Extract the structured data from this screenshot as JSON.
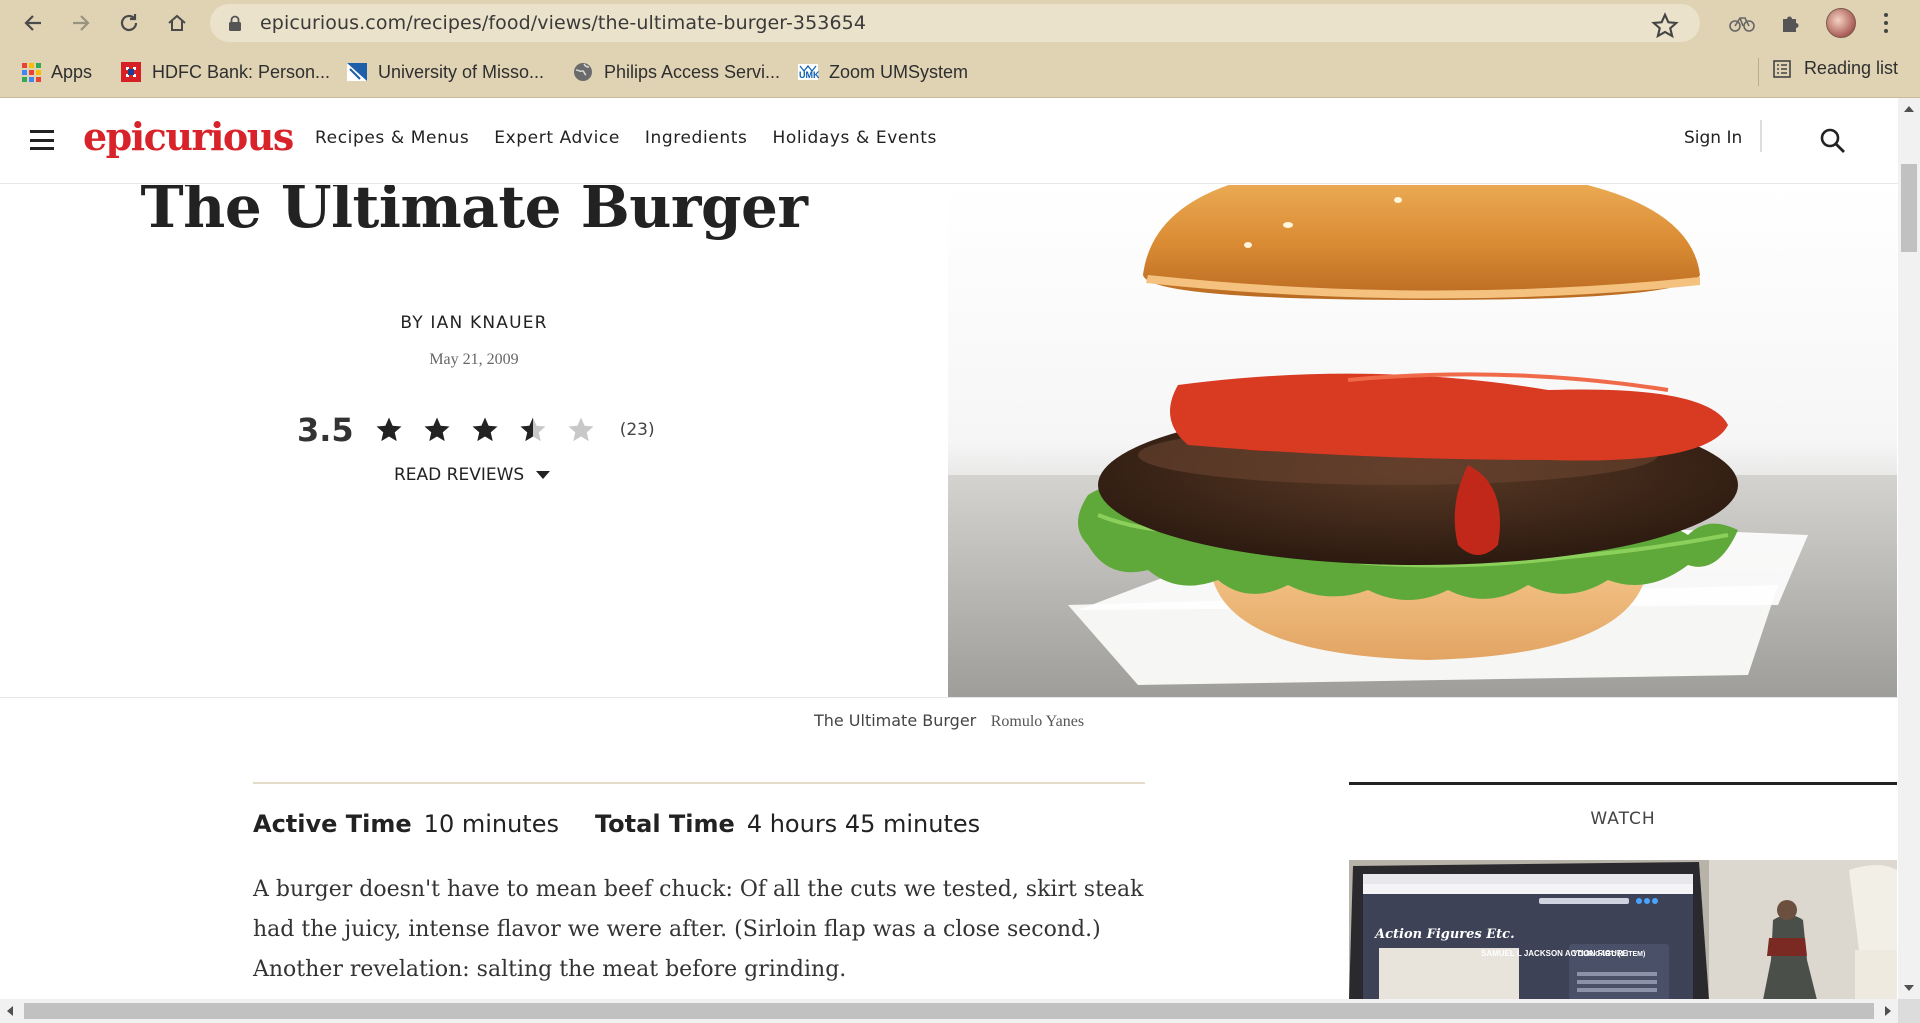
{
  "browser": {
    "url": "epicurious.com/recipes/food/views/the-ultimate-burger-353654",
    "bookmarks": [
      {
        "label": "Apps",
        "icon": "apps-grid-icon"
      },
      {
        "label": "HDFC Bank: Person...",
        "icon": "hdfc-logo-icon"
      },
      {
        "label": "University of Misso...",
        "icon": "university-flag-icon"
      },
      {
        "label": "Philips Access Servi...",
        "icon": "globe-icon"
      },
      {
        "label": "Zoom UMSystem",
        "icon": "umkc-logo-icon"
      }
    ],
    "reading_list": "Reading list"
  },
  "site": {
    "logo": "epicurious",
    "nav": [
      "Recipes & Menus",
      "Expert Advice",
      "Ingredients",
      "Holidays & Events"
    ],
    "sign_in": "Sign In",
    "brand_color": "#d8232a"
  },
  "recipe": {
    "title": "The Ultimate Burger",
    "byline": "BY IAN KNAUER",
    "date": "May 21, 2009",
    "rating": "3.5",
    "rating_fraction": 0.7,
    "rating_count": "(23)",
    "read_reviews": "READ REVIEWS",
    "image_caption": "The Ultimate Burger",
    "image_credit": "Romulo Yanes",
    "active_time_label": "Active Time",
    "active_time": "10 minutes",
    "total_time_label": "Total Time",
    "total_time": "4 hours 45 minutes",
    "description": "A burger doesn't have to mean beef chuck: Of all the cuts we tested, skirt steak had the juicy, intense flavor we were after. (Sirloin flap was a close second.) Another revelation: salting the meat before grinding."
  },
  "watch": {
    "label": "WATCH",
    "thumb_brand": "Action Figures Etc.",
    "thumb_product": "SAMUEL L JACKSON ACTION FIGURE",
    "thumb_cart": "YOUR CART: (1 ITEM)"
  }
}
